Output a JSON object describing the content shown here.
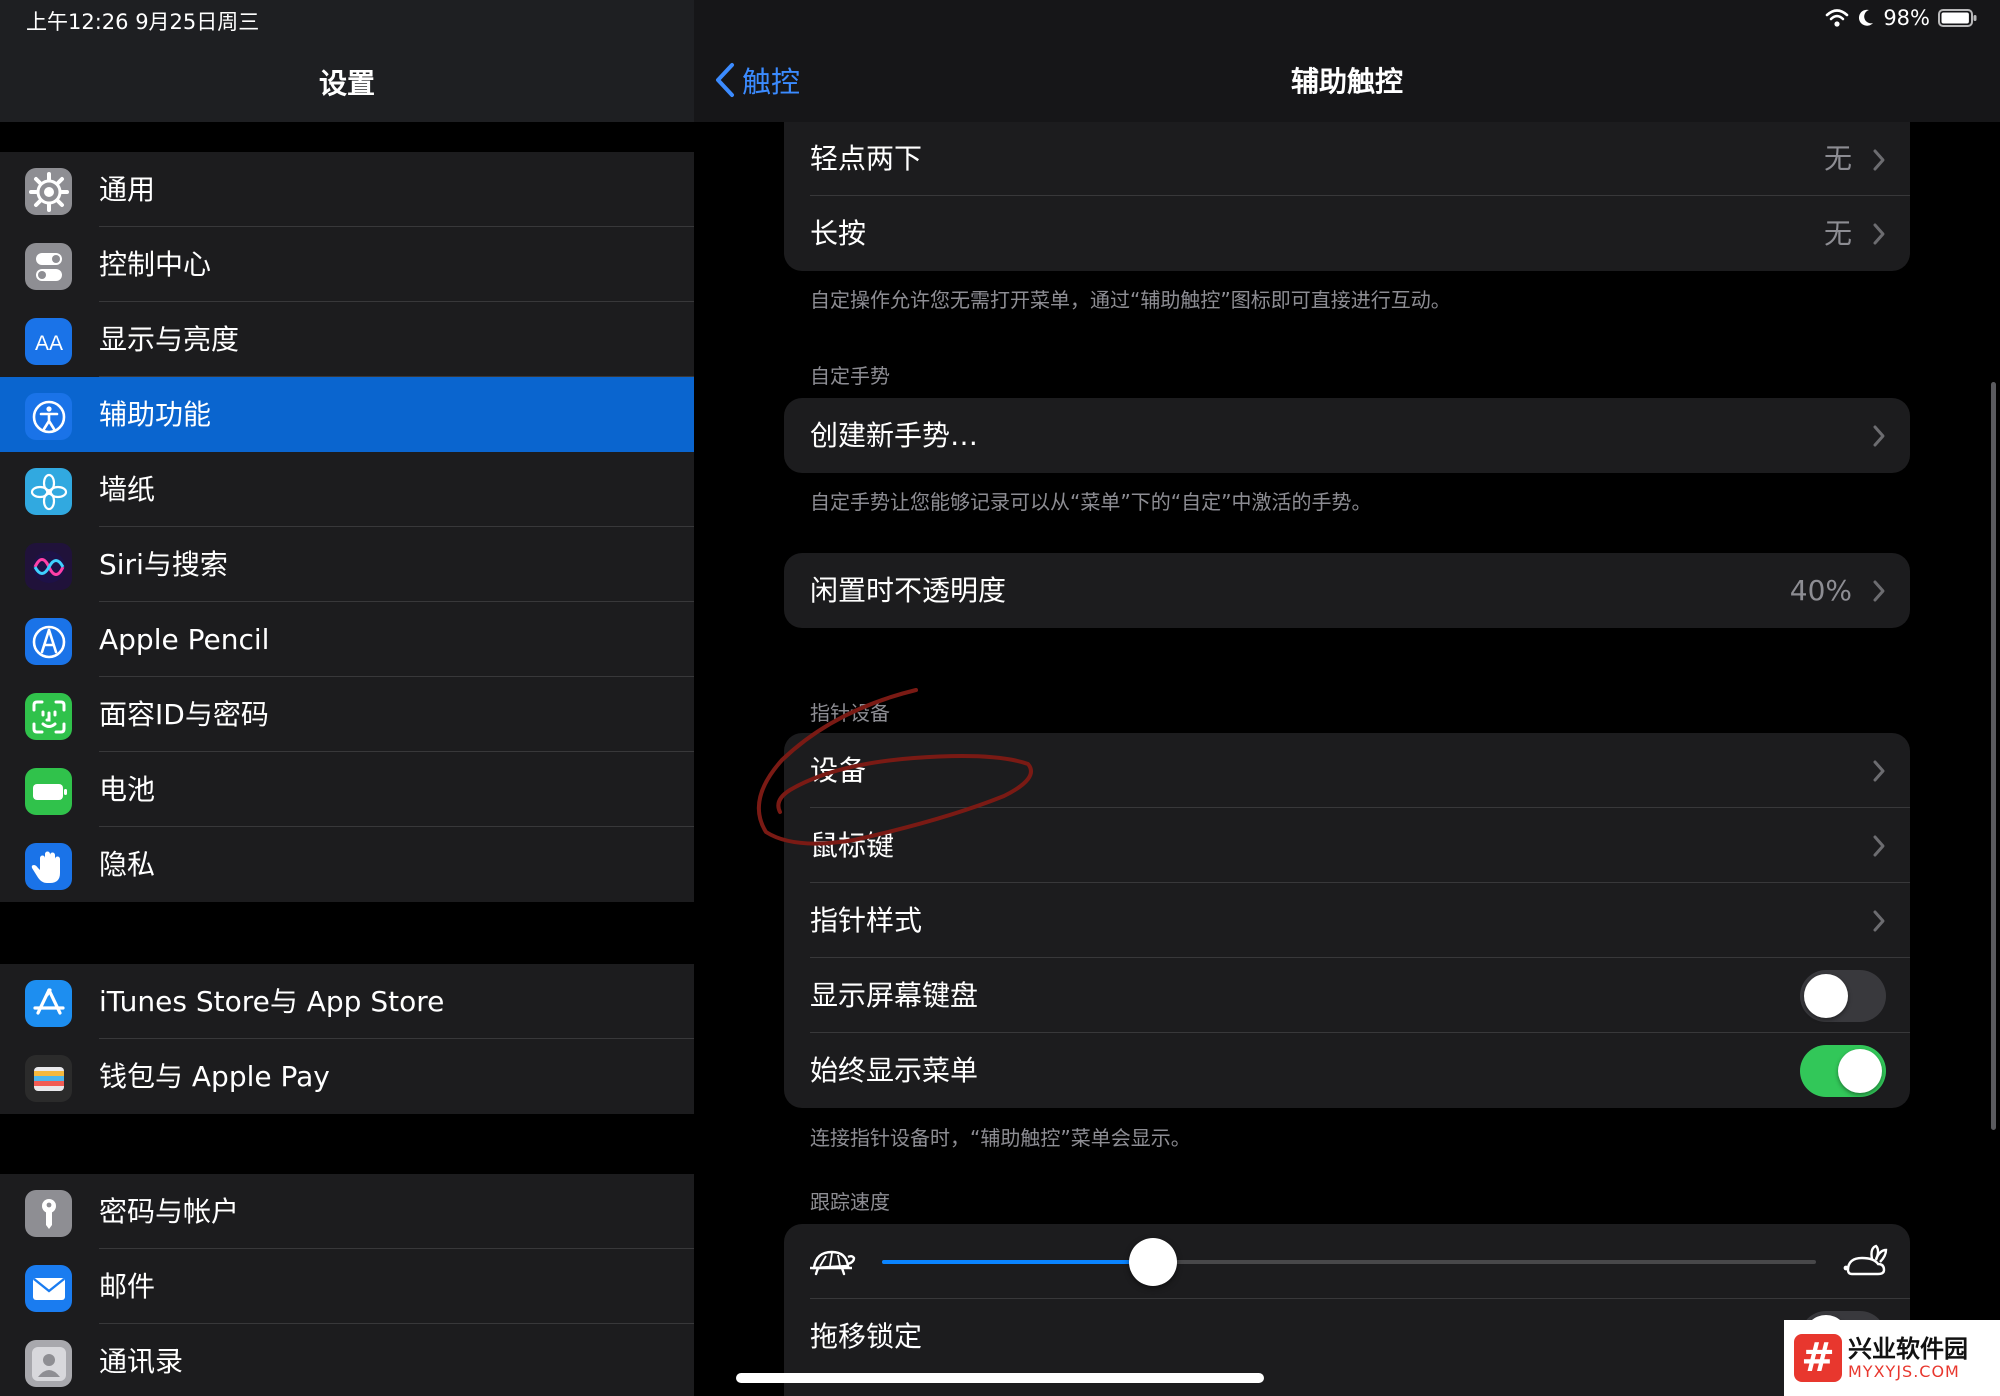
{
  "status_bar": {
    "time_date": "上午12:26   9月25日周三",
    "battery_percent": "98%",
    "battery_level": 0.98
  },
  "left": {
    "title": "设置",
    "group1": [
      {
        "label": "通用",
        "icon": "gear-icon",
        "color": "#8e8e93"
      },
      {
        "label": "控制中心",
        "icon": "switches-icon",
        "color": "#8e8e93"
      },
      {
        "label": "显示与亮度",
        "icon": "text-size-icon",
        "color": "#1a73e8"
      },
      {
        "label": "辅助功能",
        "icon": "accessibility-icon",
        "color": "#1a73e8",
        "selected": true
      },
      {
        "label": "墙纸",
        "icon": "flower-icon",
        "color": "#31a9e0"
      },
      {
        "label": "Siri与搜索",
        "icon": "siri-icon",
        "color": "#20123a"
      },
      {
        "label": "Apple Pencil",
        "icon": "pencil-icon",
        "color": "#1a73e8"
      },
      {
        "label": "面容ID与密码",
        "icon": "face-id-icon",
        "color": "#30c24b"
      },
      {
        "label": "电池",
        "icon": "battery-icon",
        "color": "#30c24b"
      },
      {
        "label": "隐私",
        "icon": "hand-icon",
        "color": "#1a73e8"
      }
    ],
    "group2": [
      {
        "label": "iTunes Store与 App Store",
        "icon": "app-store-icon",
        "color": "#1d8ef0"
      },
      {
        "label": "钱包与 Apple Pay",
        "icon": "wallet-icon",
        "color": "#2b2b2b"
      }
    ],
    "group3": [
      {
        "label": "密码与帐户",
        "icon": "key-icon",
        "color": "#8e8e93"
      },
      {
        "label": "邮件",
        "icon": "mail-icon",
        "color": "#1a7cf0"
      },
      {
        "label": "通讯录",
        "icon": "contacts-icon",
        "color": "#a8a8ad"
      }
    ]
  },
  "right": {
    "back_label": "触控",
    "title": "辅助触控",
    "custom_actions": [
      {
        "label": "轻点两下",
        "value": "无"
      },
      {
        "label": "长按",
        "value": "无"
      }
    ],
    "custom_actions_footer": "自定操作允许您无需打开菜单，通过“辅助触控”图标即可直接进行互动。",
    "custom_gestures_header": "自定手势",
    "create_gesture_label": "创建新手势…",
    "custom_gestures_footer": "自定手势让您能够记录可以从“菜单”下的“自定”中激活的手势。",
    "idle_opacity": {
      "label": "闲置时不透明度",
      "value": "40%"
    },
    "pointer_header": "指针设备",
    "pointer_rows": [
      {
        "label": "设备",
        "type": "link"
      },
      {
        "label": "鼠标键",
        "type": "link"
      },
      {
        "label": "指针样式",
        "type": "link"
      },
      {
        "label": "显示屏幕键盘",
        "type": "toggle",
        "on": false
      },
      {
        "label": "始终显示菜单",
        "type": "toggle",
        "on": true
      }
    ],
    "pointer_footer": "连接指针设备时，“辅助触控”菜单会显示。",
    "tracking_header": "跟踪速度",
    "tracking_speed": 0.29,
    "drag_lock_label": "拖移锁定",
    "accent_color": "#0a84ff"
  },
  "watermark": {
    "logo_char": "#",
    "name": "兴业软件园",
    "url": "MYXYJS.COM"
  }
}
